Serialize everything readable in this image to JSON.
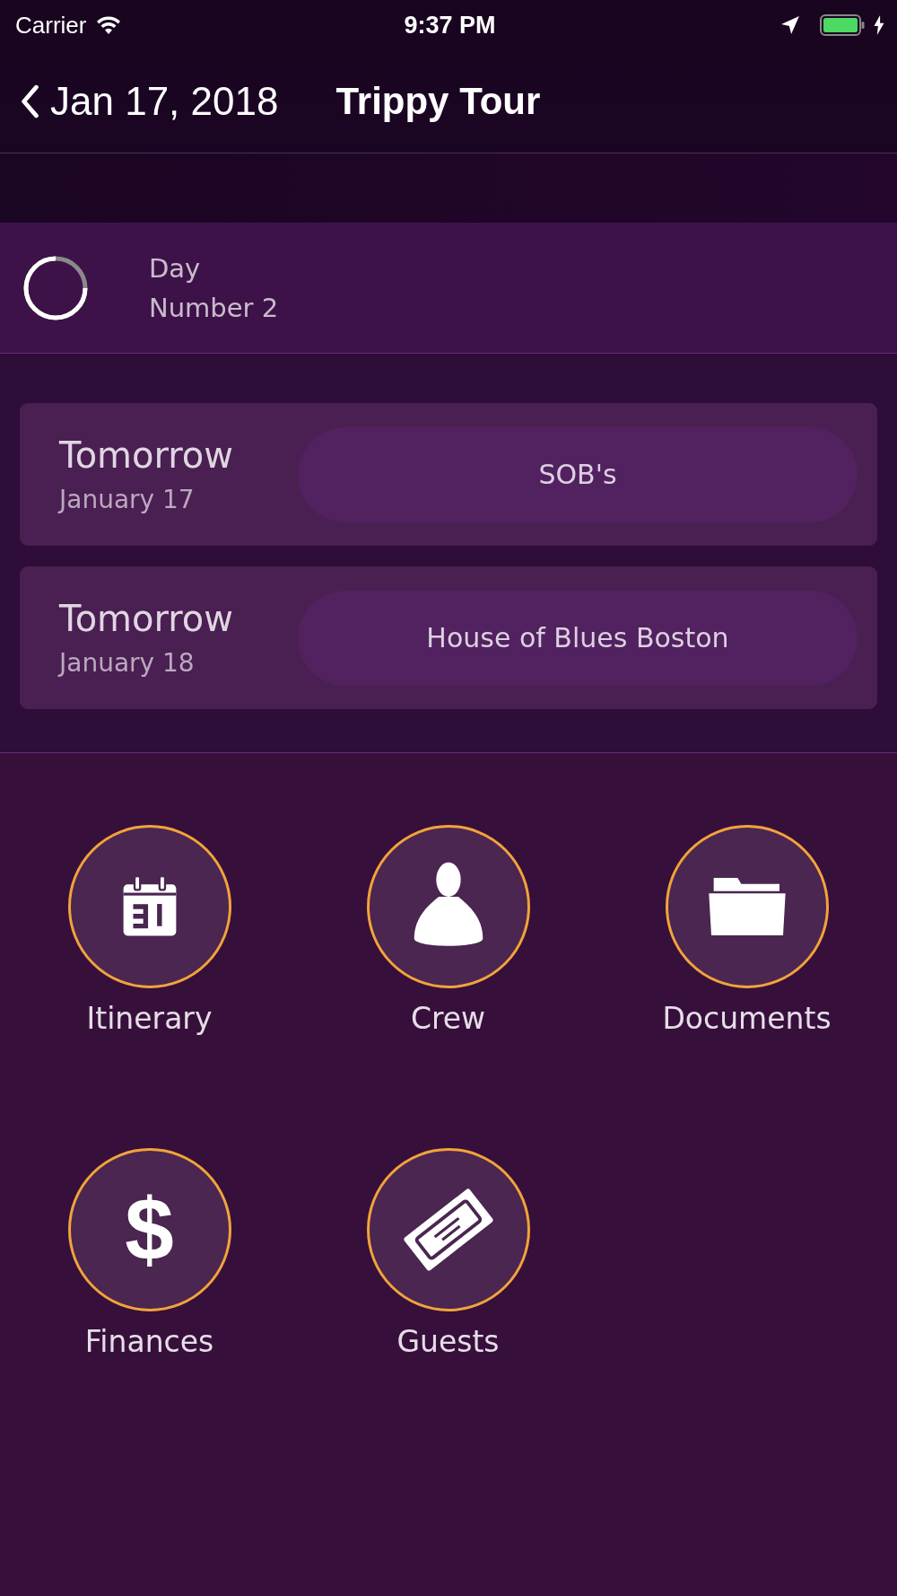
{
  "status_bar": {
    "carrier": "Carrier",
    "time": "9:37 PM"
  },
  "nav_bar": {
    "back_label": "Jan 17, 2018",
    "title": "Trippy Tour"
  },
  "day": {
    "label": "Day",
    "value": "Number 2"
  },
  "events": [
    {
      "when": "Tomorrow",
      "date": "January 17",
      "venue": "SOB's"
    },
    {
      "when": "Tomorrow",
      "date": "January 18",
      "venue": "House of Blues Boston"
    }
  ],
  "menu": [
    {
      "kind": "calendar",
      "label": "Itinerary"
    },
    {
      "kind": "person",
      "label": "Crew"
    },
    {
      "kind": "folder",
      "label": "Documents"
    },
    {
      "kind": "symbol",
      "symbol": "$",
      "label": "Finances"
    },
    {
      "kind": "ticket",
      "label": "Guests"
    }
  ]
}
